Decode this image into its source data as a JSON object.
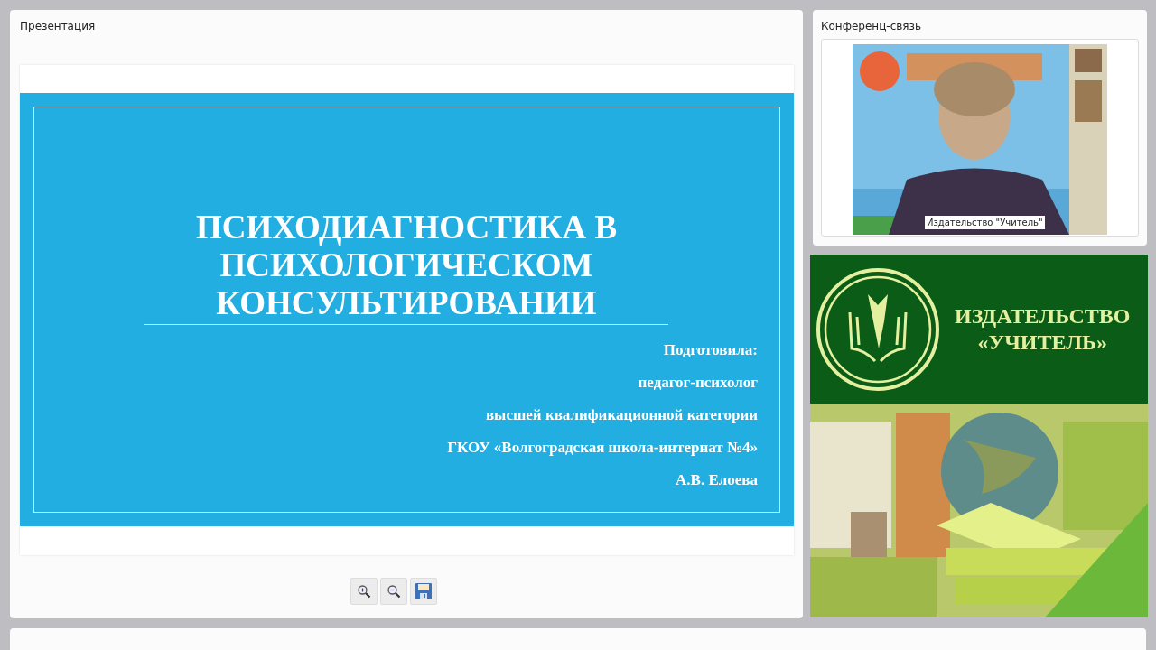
{
  "presentation": {
    "title": "Презентация",
    "slide": {
      "title": "ПСИХОДИАГНОСТИКА В ПСИХОЛОГИЧЕСКОМ КОНСУЛЬТИРОВАНИИ",
      "lines": [
        "Подготовила:",
        "педагог-психолог",
        "высшей квалификационной категории",
        "ГКОУ «Волгоградская школа-интернат №4»",
        "А.В. Елоева"
      ]
    },
    "toolbar": [
      {
        "kind": "zoom-in"
      },
      {
        "kind": "zoom-out"
      },
      {
        "kind": "save"
      }
    ]
  },
  "conference": {
    "title": "Конференц-связь",
    "video": {
      "kind": "picture",
      "caption": "Издательство \"Учитель\""
    }
  },
  "banner": {
    "lines": [
      "ИЗДАТЕЛЬСТВО",
      "«УЧИТЕЛЬ»"
    ],
    "image": {
      "kind": "picture"
    }
  }
}
